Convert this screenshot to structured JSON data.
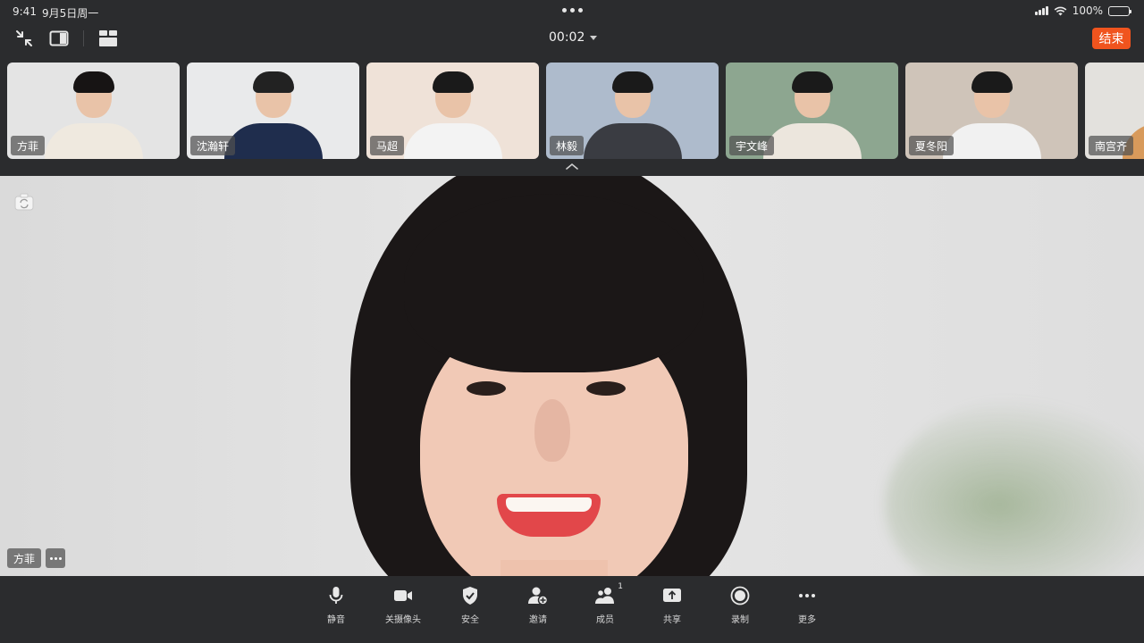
{
  "status_bar": {
    "time": "9:41",
    "date": "9月5日周一",
    "battery": "100%",
    "battery_level": 1.0
  },
  "top_bar": {
    "timer": "00:02",
    "end_label": "结束",
    "end_color": "#f0541e",
    "icons": [
      "minimize-icon",
      "split-view-icon",
      "gallery-layout-icon"
    ]
  },
  "participants": [
    {
      "name": "方菲",
      "bg": "#e4e4e4",
      "shirt": "#efe9df",
      "hair": "#171414"
    },
    {
      "name": "沈瀚轩",
      "bg": "#e9eaeb",
      "shirt": "#1f2d4d",
      "hair": "#222"
    },
    {
      "name": "马超",
      "bg": "#efe2d8",
      "shirt": "#f3f3f3",
      "hair": "#1a1a1a"
    },
    {
      "name": "林毅",
      "bg": "#aebbcc",
      "shirt": "#3a3c42",
      "hair": "#1a1a1a"
    },
    {
      "name": "宇文峰",
      "bg": "#8da690",
      "shirt": "#ece6dd",
      "hair": "#1a1a1a"
    },
    {
      "name": "夏冬阳",
      "bg": "#cfc4b9",
      "shirt": "#f1f1f1",
      "hair": "#1a1a1a"
    },
    {
      "name": "南宫齐",
      "bg": "#e3e1dd",
      "shirt": "#d89a5b",
      "hair": "#1a1a1a"
    }
  ],
  "main_video": {
    "speaker_name": "方菲"
  },
  "bottom_bar": {
    "items": [
      {
        "label": "静音",
        "icon": "microphone-icon"
      },
      {
        "label": "关摄像头",
        "icon": "video-camera-icon"
      },
      {
        "label": "安全",
        "icon": "shield-icon"
      },
      {
        "label": "邀请",
        "icon": "add-user-icon"
      },
      {
        "label": "成员",
        "icon": "members-icon",
        "badge": "1"
      },
      {
        "label": "共享",
        "icon": "share-screen-icon"
      },
      {
        "label": "录制",
        "icon": "record-icon"
      },
      {
        "label": "更多",
        "icon": "more-icon"
      }
    ]
  }
}
